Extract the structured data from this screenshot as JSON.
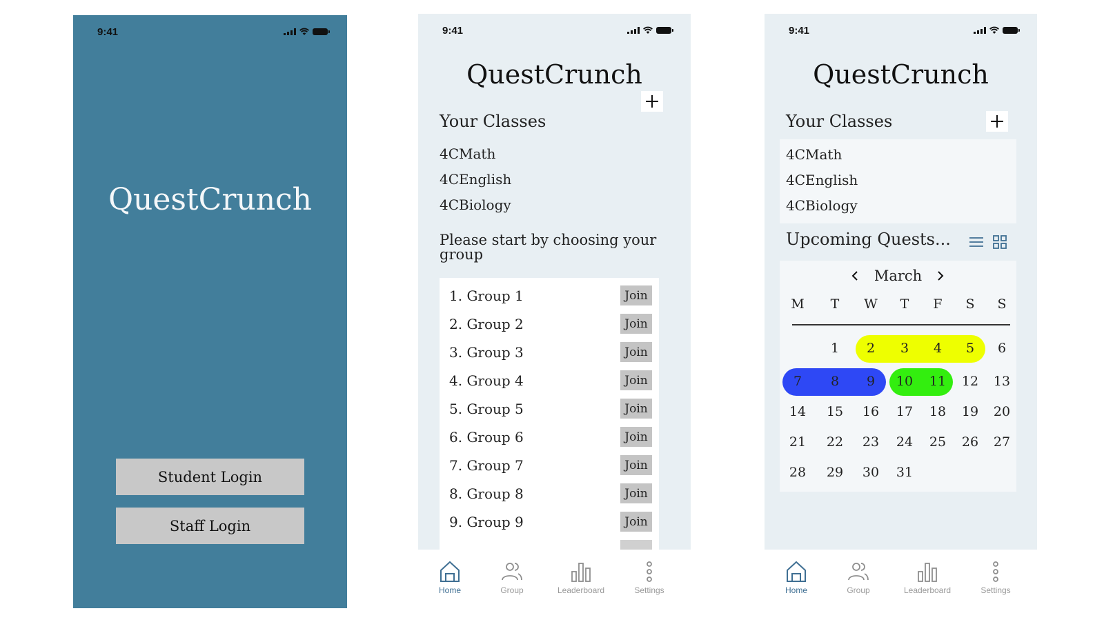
{
  "status_time": "9:41",
  "app_title": "QuestCrunch",
  "login": {
    "student_label": "Student Login",
    "staff_label": "Staff Login"
  },
  "classes": {
    "title": "Your Classes",
    "add_label": "+",
    "items": [
      "4CMath",
      "4CEnglish",
      "4CBiology"
    ]
  },
  "groups": {
    "prompt": "Please start by choosing your group",
    "join_label": "Join",
    "items": [
      "1. Group 1",
      "2. Group 2",
      "3. Group 3",
      "4. Group 4",
      "5. Group 5",
      "6. Group 6",
      "7. Group 7",
      "8. Group 8",
      "9. Group 9"
    ]
  },
  "upcoming": {
    "title": "Upcoming Quests...",
    "view_icons": [
      "list-view-icon",
      "grid-view-icon"
    ]
  },
  "calendar": {
    "month": "March",
    "weekdays": [
      "M",
      "T",
      "W",
      "T",
      "F",
      "S",
      "S"
    ],
    "weeks": [
      [
        "",
        "1",
        "2",
        "3",
        "4",
        "5",
        "6"
      ],
      [
        "7",
        "8",
        "9",
        "10",
        "11",
        "12",
        "13"
      ],
      [
        "14",
        "15",
        "16",
        "17",
        "18",
        "19",
        "20"
      ],
      [
        "21",
        "22",
        "23",
        "24",
        "25",
        "26",
        "27"
      ],
      [
        "28",
        "29",
        "30",
        "31",
        "",
        "",
        ""
      ]
    ],
    "highlights": [
      {
        "days": [
          "2",
          "3",
          "4",
          "5"
        ],
        "color": "#eeff00"
      },
      {
        "days": [
          "7",
          "8",
          "9"
        ],
        "color": "#2e48f5"
      },
      {
        "days": [
          "10",
          "11"
        ],
        "color": "#33ee0f"
      }
    ]
  },
  "tabs": [
    {
      "label": "Home",
      "icon": "home-icon",
      "active": true
    },
    {
      "label": "Group",
      "icon": "group-icon",
      "active": false
    },
    {
      "label": "Leaderboard",
      "icon": "leaderboard-icon",
      "active": false
    },
    {
      "label": "Settings",
      "icon": "settings-dots-icon",
      "active": false
    }
  ],
  "colors": {
    "splash_bg": "#427e9b",
    "screen_bg": "#e8eff3",
    "button_gray": "#c8c8c8",
    "tab_active": "#3f6f93",
    "tab_inactive": "#9a9a9a"
  }
}
